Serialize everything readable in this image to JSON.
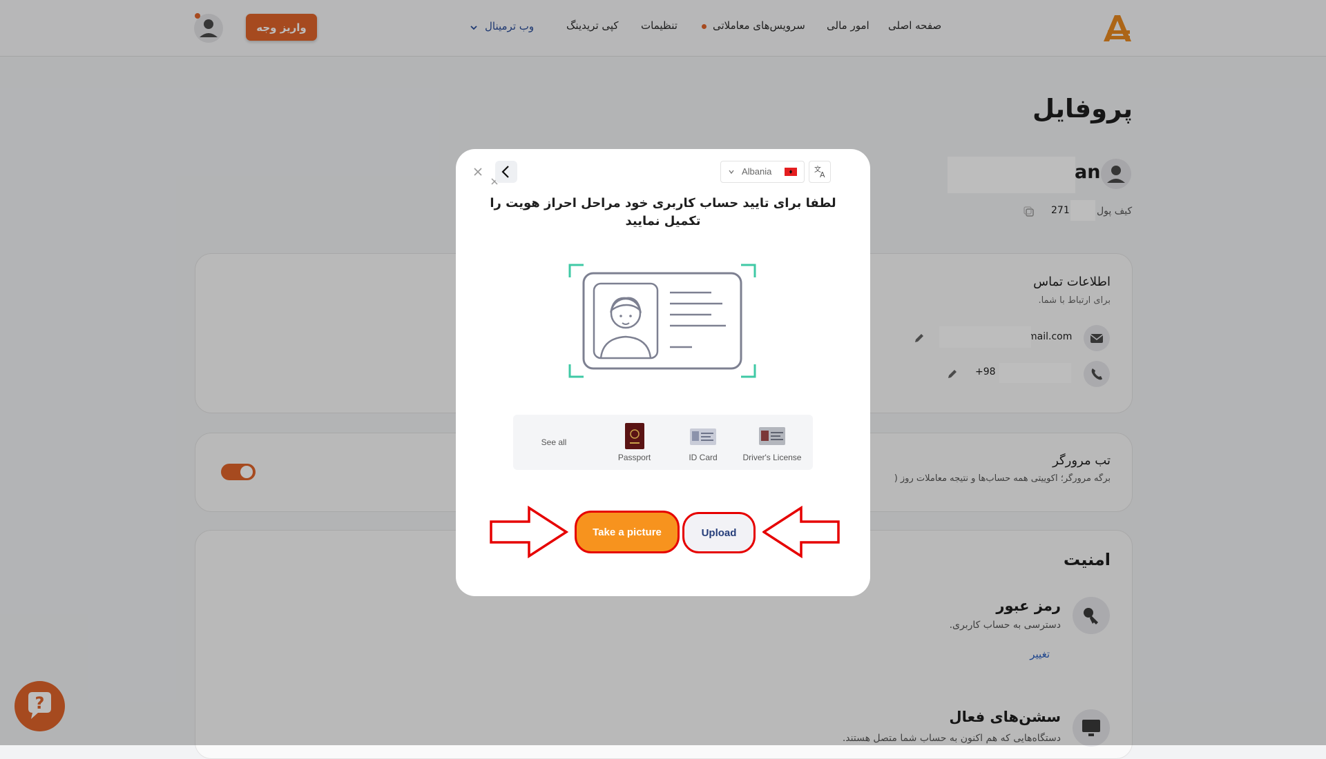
{
  "nav": {
    "items": [
      "صفحه اصلی",
      "امور مالی",
      "سرویس‌های معاملاتی",
      "تنظیمات",
      "کپی تریدینگ",
      "وب ترمینال"
    ],
    "deposit_label": "واریز وجه"
  },
  "profile": {
    "title": "پروفایل",
    "name_suffix": "an",
    "wallet_label": "کیف پول",
    "wallet_prefix": "271"
  },
  "contact": {
    "title": "اطلاعات تماس",
    "subtitle": "برای ارتباط با شما.",
    "email_suffix": "mail.com",
    "phone_prefix": "+98 ("
  },
  "browser_tab": {
    "title": "تب مرورگر",
    "desc": "برگه مرورگر؛ اکوییتی همه حساب‌ها و نتیجه معاملات روز ("
  },
  "security": {
    "title": "امنیت",
    "password_title": "رمز عبور",
    "password_desc": "دسترسی به حساب کاربری.",
    "change_link": "تغییر",
    "sessions_title": "سشن‌های فعال",
    "sessions_desc": "دستگاه‌هایی که هم اکنون به حساب شما متصل هستند."
  },
  "modal": {
    "country": "Albania",
    "heading_line1": "لطفا برای تایید حساب کاربری خود مراحل احراز هویت را",
    "heading_line2": "تکمیل نمایید",
    "see_all": "See all",
    "docs": [
      "Passport",
      "ID Card",
      "Driver's License"
    ],
    "take_picture": "Take a picture",
    "upload": "Upload"
  },
  "colors": {
    "brand_orange": "#e0642a",
    "take_button": "#f7931e",
    "highlight_red": "#e60000",
    "link_blue": "#2a5fbf"
  }
}
